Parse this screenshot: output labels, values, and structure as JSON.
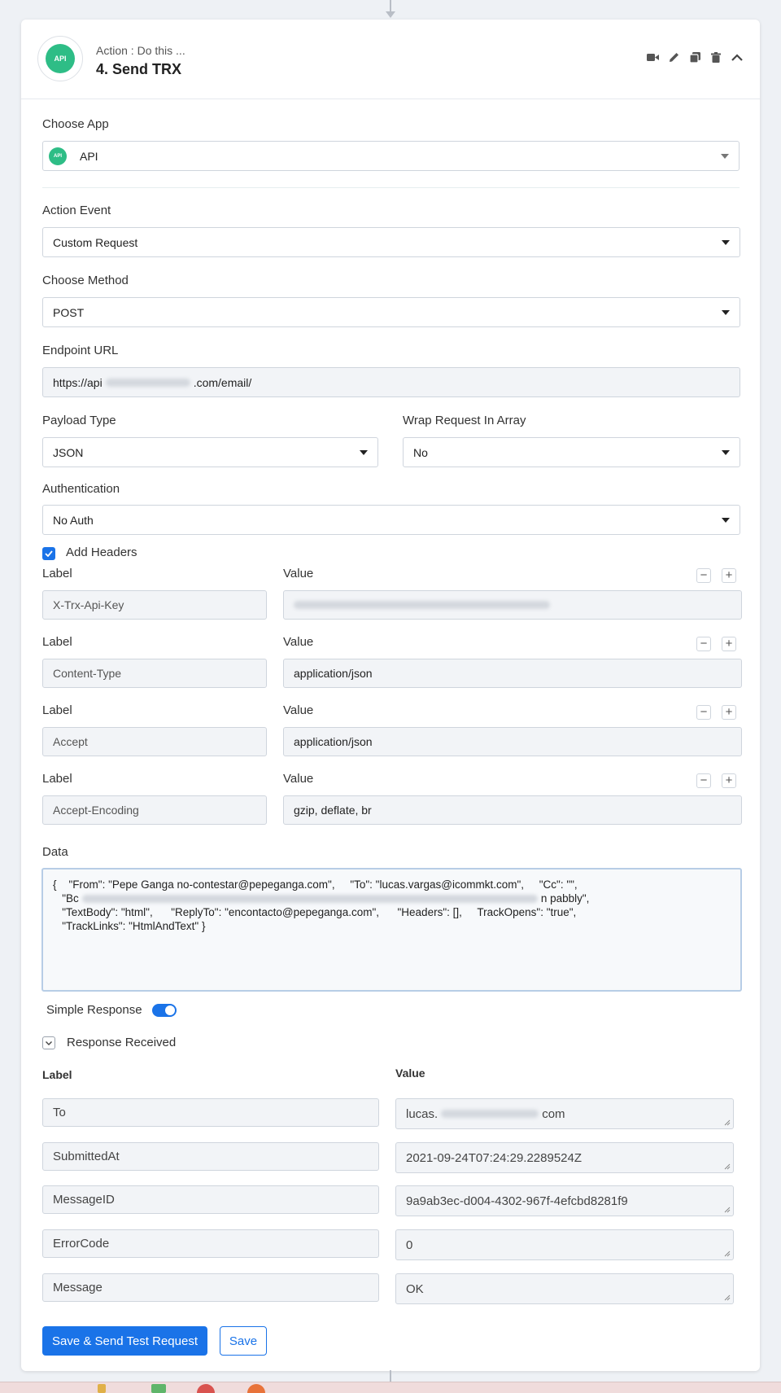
{
  "step": {
    "subtitle": "Action : Do this ...",
    "title": "4. Send TRX",
    "logo_text": "API"
  },
  "header_icons": [
    "video-icon",
    "pencil-icon",
    "copy-icon",
    "trash-icon",
    "chevron-up-icon"
  ],
  "choose_app": {
    "label": "Choose App",
    "value": "API"
  },
  "action_event": {
    "label": "Action Event",
    "value": "Custom Request"
  },
  "choose_method": {
    "label": "Choose Method",
    "value": "POST"
  },
  "endpoint": {
    "label": "Endpoint URL",
    "prefix": "https://api",
    "suffix": ".com/email/"
  },
  "payload_type": {
    "label": "Payload Type",
    "value": "JSON"
  },
  "wrap_request": {
    "label": "Wrap Request In Array",
    "value": "No"
  },
  "authentication": {
    "label": "Authentication",
    "value": "No Auth"
  },
  "add_headers": {
    "label": "Add Headers",
    "checked": true
  },
  "headers": [
    {
      "label_caption": "Label",
      "value_caption": "Value",
      "label": "X-Trx-Api-Key",
      "value": ""
    },
    {
      "label_caption": "Label",
      "value_caption": "Value",
      "label": "Content-Type",
      "value": "application/json"
    },
    {
      "label_caption": "Label",
      "value_caption": "Value",
      "label": "Accept",
      "value": "application/json"
    },
    {
      "label_caption": "Label",
      "value_caption": "Value",
      "label": "Accept-Encoding",
      "value": "gzip, deflate, br"
    }
  ],
  "data": {
    "label": "Data",
    "line1": "{    \"From\": \"Pepe Ganga no-contestar@pepeganga.com\",     \"To\": \"lucas.vargas@icommkt.com\",     \"Cc\": \"\",",
    "line2a": "   \"Bc",
    "line2b": "n pabbly\",",
    "line3a": "   \"TextBody\": \"html\",      \"ReplyTo\": \"encontacto@pepeganga.com\",      \"Headers\": [],     ",
    "line3b": "TrackOpens\": \"true\",",
    "line4": "   \"TrackLinks\": \"HtmlAndText\" }"
  },
  "simple_response": {
    "label": "Simple Response",
    "enabled": true
  },
  "response_received": {
    "label": "Response Received",
    "label_header": "Label",
    "value_header": "Value",
    "rows": [
      {
        "label": "To",
        "value_prefix": "lucas.",
        "value_suffix": "com"
      },
      {
        "label": "SubmittedAt",
        "value": "2021-09-24T07:24:29.2289524Z"
      },
      {
        "label": "MessageID",
        "value": "9a9ab3ec-d004-4302-967f-4efcbd8281f9"
      },
      {
        "label": "ErrorCode",
        "value": "0"
      },
      {
        "label": "Message",
        "value": "OK"
      }
    ]
  },
  "buttons": {
    "save_send": "Save & Send Test Request",
    "save": "Save"
  },
  "colors": {
    "primary": "#1a73e8",
    "api_green": "#2ebd86"
  }
}
